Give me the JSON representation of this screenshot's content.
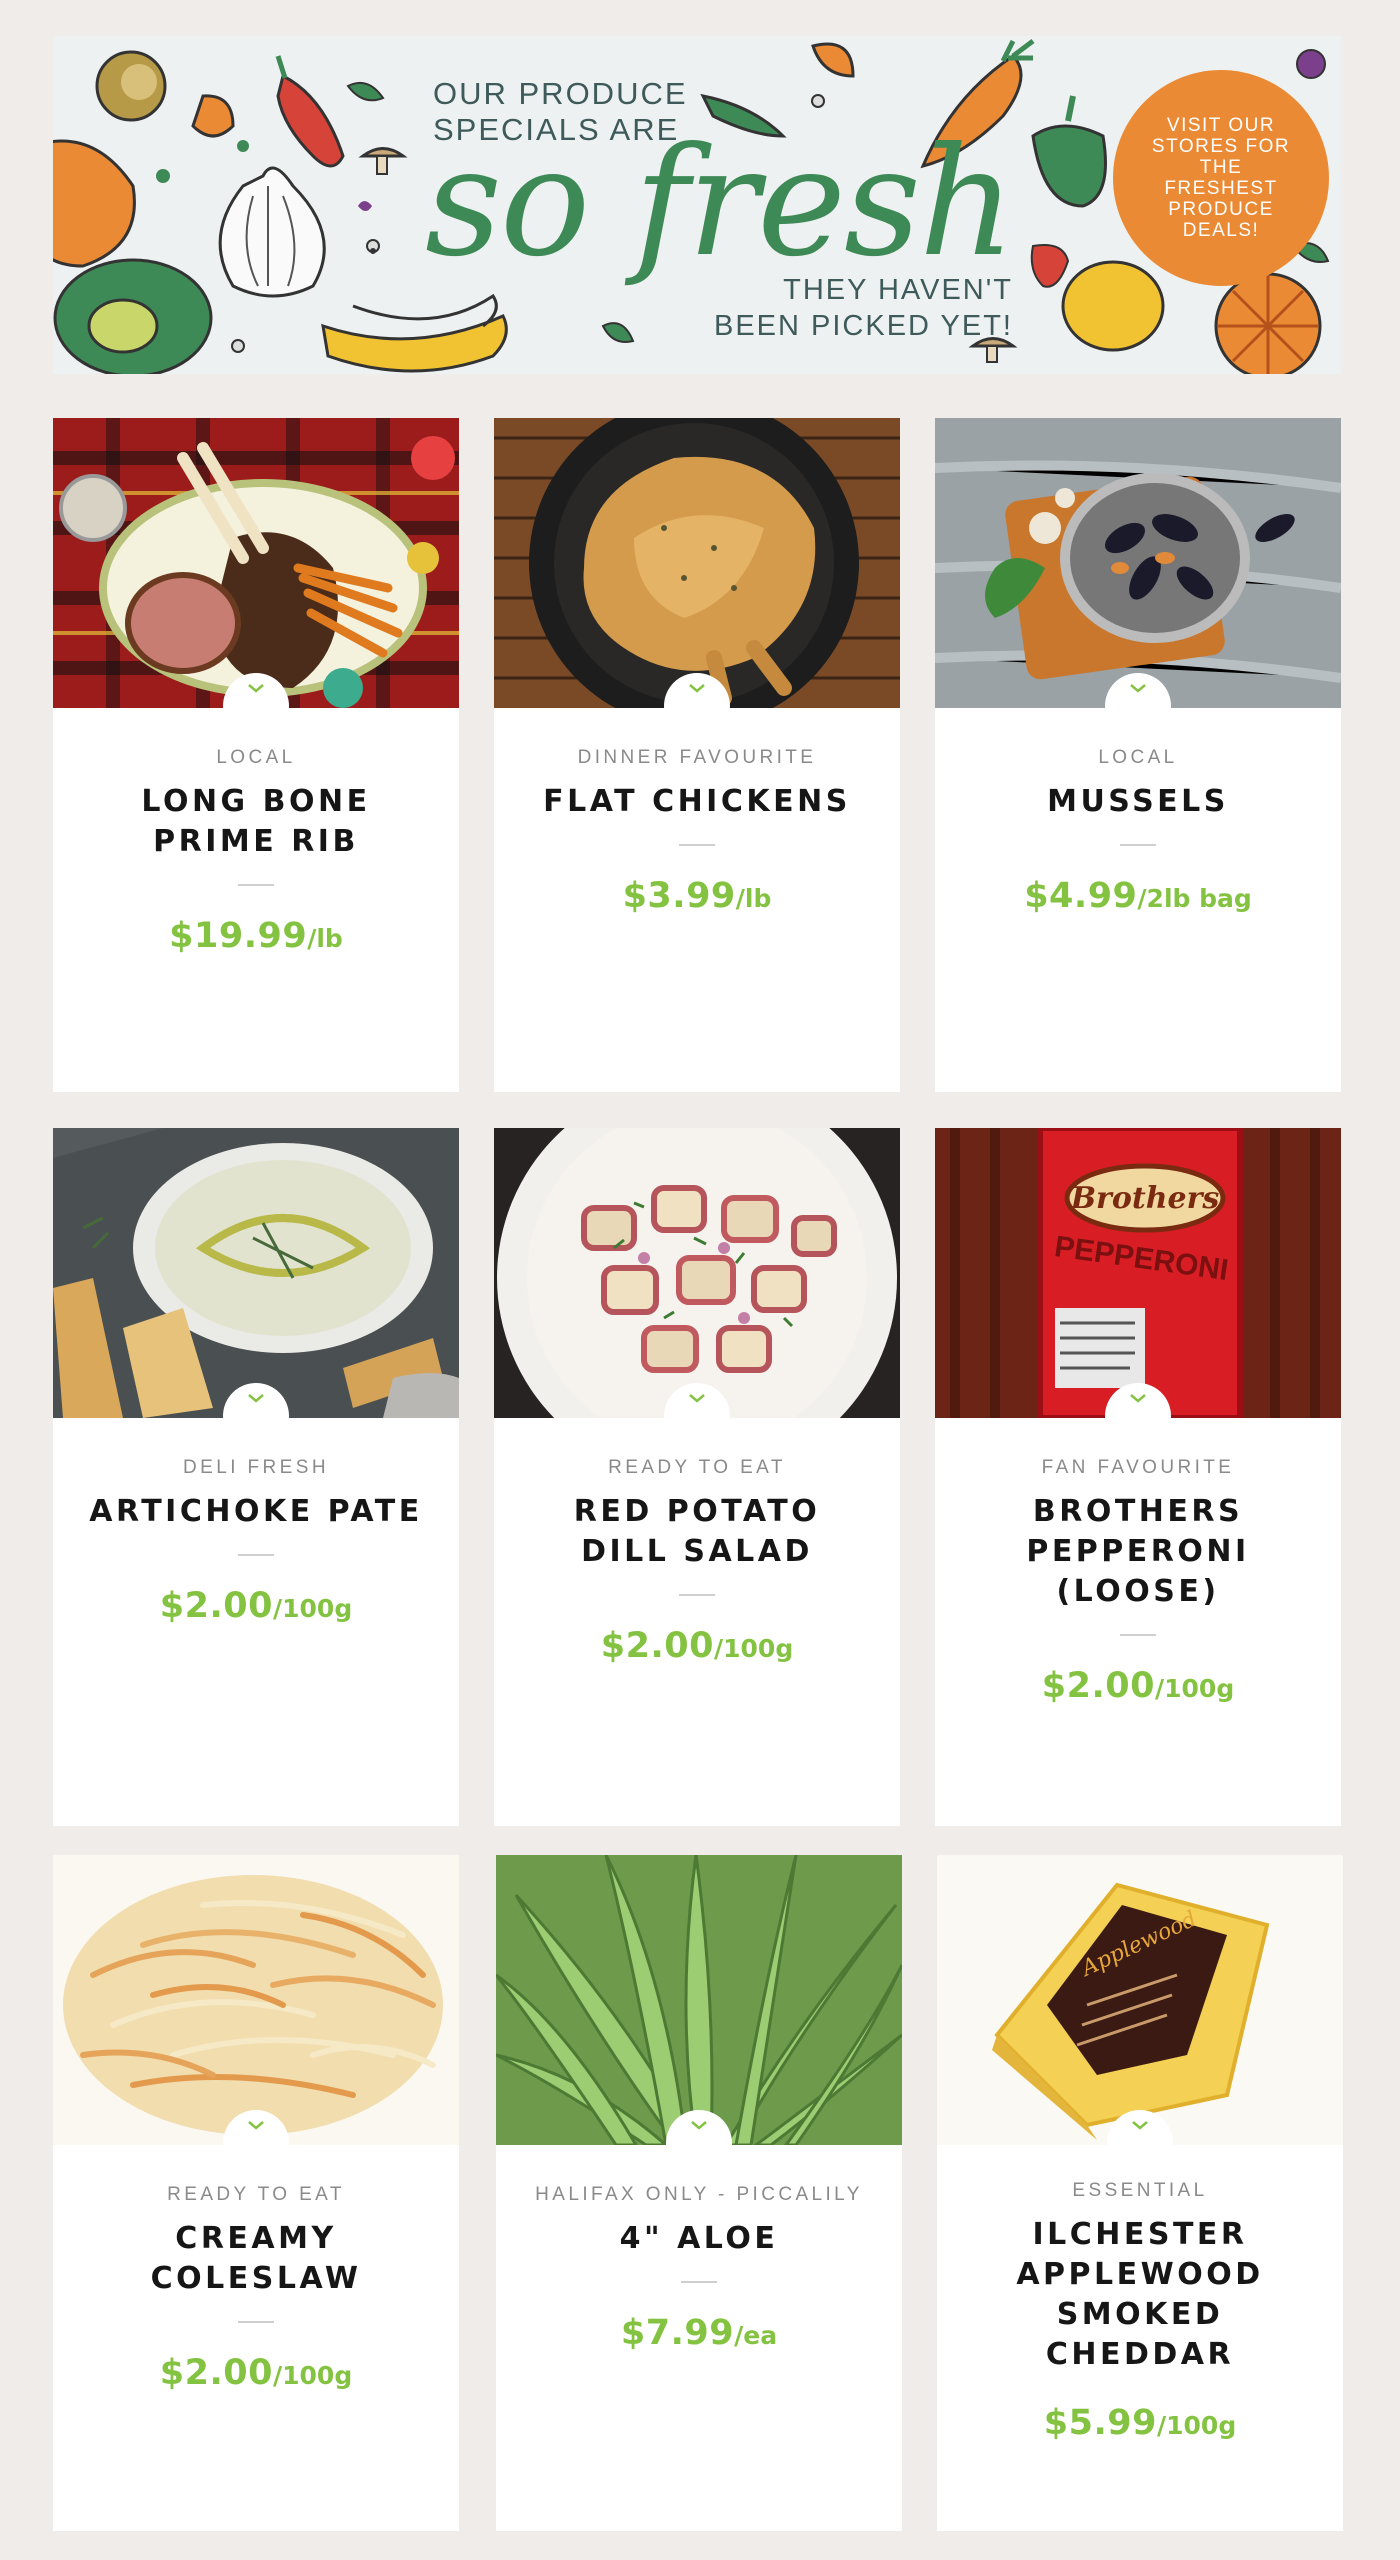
{
  "banner": {
    "intro": [
      "OUR PRODUCE",
      "SPECIALS ARE"
    ],
    "headline": "so fresh",
    "tagline": [
      "THEY HAVEN'T",
      "BEEN PICKED YET!"
    ],
    "badge": "VISIT OUR STORES FOR THE FRESHEST PRODUCE DEALS!",
    "colors": {
      "green": "#3e8a57",
      "orange": "#eb8a34",
      "text": "#3e5a5a",
      "background": "#eef1f1"
    }
  },
  "theme": {
    "price_color": "#84c341",
    "page_background": "#efecea"
  },
  "products": [
    {
      "image": "prime-rib-image",
      "category": "LOCAL",
      "title": [
        "LONG BONE",
        "PRIME RIB"
      ],
      "price": "$19.99",
      "unit": "/lb"
    },
    {
      "image": "flat-chicken-image",
      "category": "DINNER FAVOURITE",
      "title": [
        "FLAT CHICKENS"
      ],
      "price": "$3.99",
      "unit": "/lb"
    },
    {
      "image": "mussels-image",
      "category": "LOCAL",
      "title": [
        "MUSSELS"
      ],
      "price": "$4.99",
      "unit": "/2lb bag"
    },
    {
      "image": "artichoke-pate-image",
      "category": "DELI FRESH",
      "title": [
        "ARTICHOKE PATE"
      ],
      "price": "$2.00",
      "unit": "/100g"
    },
    {
      "image": "potato-salad-image",
      "category": "READY TO EAT",
      "title": [
        "RED POTATO",
        "DILL SALAD"
      ],
      "price": "$2.00",
      "unit": "/100g"
    },
    {
      "image": "pepperoni-image",
      "category": "FAN FAVOURITE",
      "title": [
        "BROTHERS",
        "PEPPERONI",
        "(LOOSE)"
      ],
      "price": "$2.00",
      "unit": "/100g",
      "label_text": [
        "Brothers",
        "PEPPERONI"
      ]
    },
    {
      "image": "coleslaw-image",
      "category": "READY TO EAT",
      "title": [
        "CREAMY",
        "COLESLAW"
      ],
      "price": "$2.00",
      "unit": "/100g"
    },
    {
      "image": "aloe-image",
      "category": "HALIFAX ONLY - PICCALILY",
      "title": [
        "4\" ALOE"
      ],
      "price": "$7.99",
      "unit": "/ea"
    },
    {
      "image": "cheddar-image",
      "category": "ESSENTIAL",
      "title": [
        "ILCHESTER",
        "APPLEWOOD",
        "SMOKED CHEDDAR"
      ],
      "price": "$5.99",
      "unit": "/100g",
      "label_text": [
        "Applewood"
      ]
    }
  ]
}
